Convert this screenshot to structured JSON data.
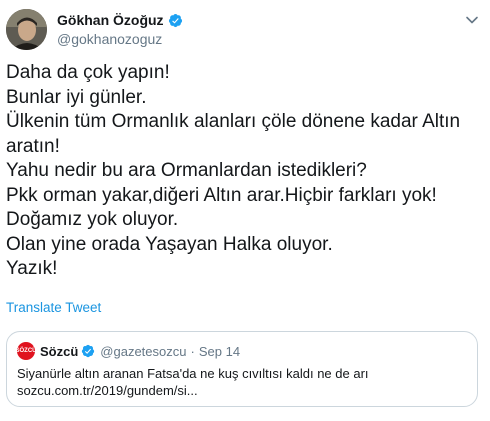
{
  "author": {
    "name": "Gökhan Özoğuz",
    "handle": "@gokhanozoguz",
    "verified": true
  },
  "tweet": {
    "lines": [
      "Daha da çok yapın!",
      "Bunlar iyi günler.",
      "Ülkenin tüm Ormanlık alanları çöle dönene kadar Altın",
      "aratın!",
      "Yahu nedir bu ara Ormanlardan istedikleri?",
      "Pkk orman yakar,diğeri Altın arar.Hiçbir farkları yok!",
      "Doğamız yok oluyor.",
      "Olan yine orada Yaşayan Halka oluyor.",
      "Yazık!"
    ],
    "translate_label": "Translate Tweet"
  },
  "quoted": {
    "name": "Sözcü",
    "handle": "@gazetesozcu",
    "separator": "·",
    "date": "Sep 14",
    "verified": true,
    "logo_text": "SÖZCÜ",
    "lines": [
      "Siyanürle altın aranan Fatsa'da ne kuş cıvıltısı kaldı ne de arı",
      "sozcu.com.tr/2019/gundem/si..."
    ]
  },
  "colors": {
    "text": "#14171a",
    "secondary": "#657786",
    "link": "#1b95e0",
    "verified": "#1da1f2",
    "border": "#ccd6dd",
    "logo": "#e0131f"
  },
  "icons": {
    "verified": "verified-badge-icon",
    "menu": "chevron-down-icon",
    "logo": "sozcu-logo-icon"
  }
}
